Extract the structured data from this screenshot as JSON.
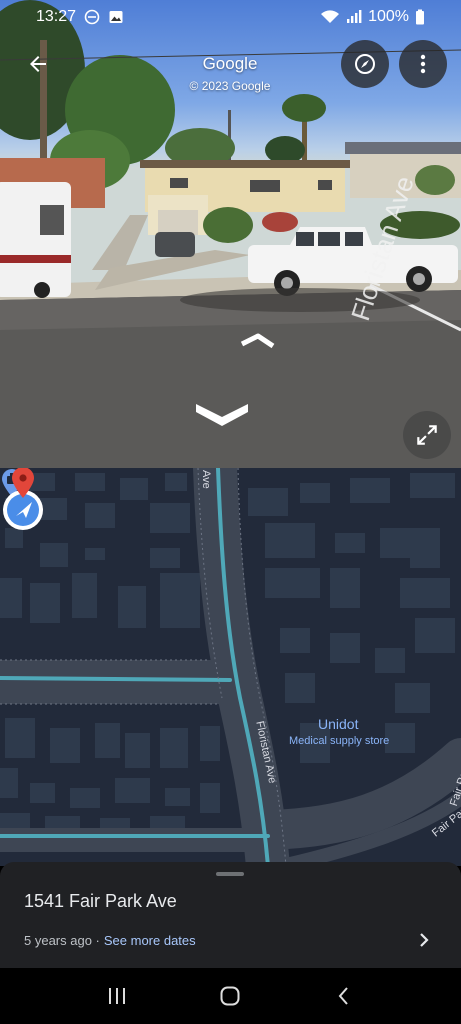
{
  "status_bar": {
    "time": "13:27",
    "battery": "100%",
    "icons": [
      "do-not-disturb-icon",
      "image-icon",
      "wifi-icon",
      "signal-icon",
      "battery-icon"
    ]
  },
  "street_view": {
    "title": "Google",
    "copyright": "© 2023 Google",
    "street_label": "Floristan Ave",
    "controls": [
      "back-arrow-icon",
      "compass-icon",
      "more-vert-icon",
      "expand-icon"
    ]
  },
  "map": {
    "street_floristan": "Floristan Ave",
    "street_floristan_top": "Ave",
    "street_fair_park_1": "Fair Park Ave",
    "street_fair_park_2": "Fair Park Ave",
    "poi_name": "Unidot",
    "poi_category": "Medical supply store"
  },
  "bottom_sheet": {
    "address": "1541 Fair Park Ave",
    "age": "5 years ago ·",
    "see_more": "See more dates"
  },
  "colors": {
    "map_background": "#222a3a",
    "road": "#3e4654",
    "route_highlight": "#4fa8b8",
    "poi_blue": "#8ab4f8",
    "pin_red": "#e2463a",
    "sheet_background": "#202124"
  }
}
